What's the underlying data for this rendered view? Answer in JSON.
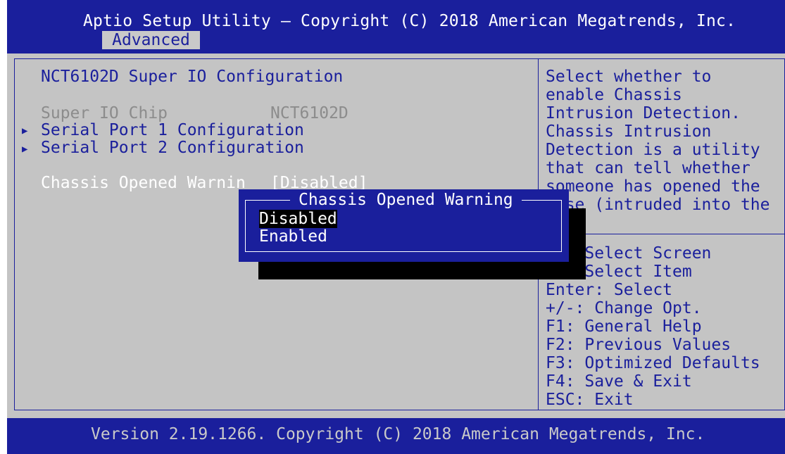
{
  "header": {
    "title": "Aptio Setup Utility – Copyright (C) 2018 American Megatrends, Inc.",
    "active_tab": "Advanced"
  },
  "page": {
    "heading": "NCT6102D Super IO Configuration",
    "chip_label": "Super IO Chip",
    "chip_value": "NCT6102D",
    "submenus": [
      {
        "label": "Serial Port 1 Configuration"
      },
      {
        "label": "Serial Port 2 Configuration"
      }
    ],
    "chassis_label": "Chassis Opened Warnin",
    "chassis_value": "[Disabled]"
  },
  "help_text": [
    "Select whether to",
    "enable Chassis",
    "Intrusion Detection.",
    "Chassis Intrusion",
    "Detection is a utility",
    "that can tell whether",
    "someone has opened the",
    "case (intruded into the"
  ],
  "key_help": [
    "→←: Select Screen",
    "↑↓: Select Item",
    "Enter: Select",
    "+/-: Change Opt.",
    "F1: General Help",
    "F2: Previous Values",
    "F3: Optimized Defaults",
    "F4: Save & Exit",
    "ESC: Exit"
  ],
  "popup": {
    "title": "Chassis Opened Warning",
    "options": [
      "Disabled",
      "Enabled"
    ],
    "selected": "Disabled"
  },
  "footer": {
    "text": "Version 2.19.1266. Copyright (C) 2018 American Megatrends, Inc."
  },
  "colors": {
    "bios_blue": "#1a1f9c",
    "panel_gray": "#c4c4c4",
    "highlight_white": "#ffffff"
  },
  "icons": {
    "submenu": "triangle-right-icon"
  }
}
